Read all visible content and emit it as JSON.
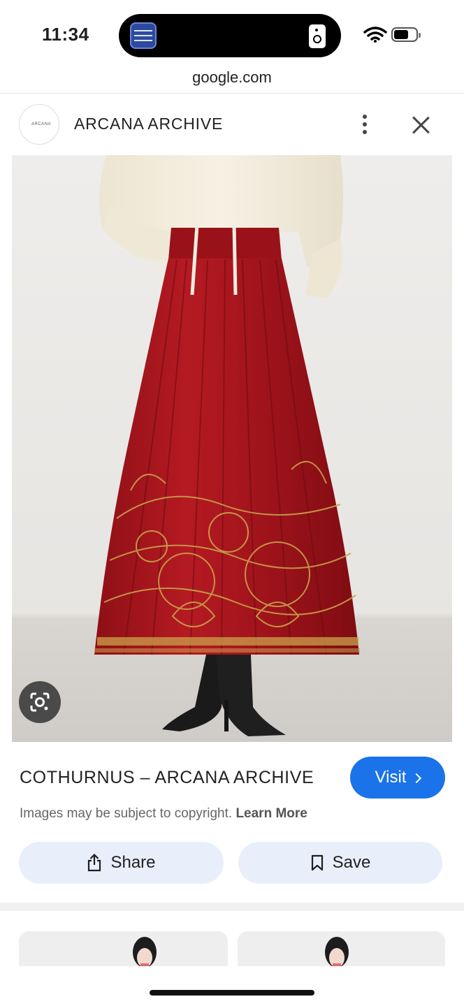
{
  "status_bar": {
    "time": "11:34",
    "island_app_icon": "masters-in-business-podcast-icon",
    "island_right_icon": "speaker-icon"
  },
  "browser": {
    "url": "google.com"
  },
  "site": {
    "logo_text": "ARCANA",
    "name": "ARCANA ARCHIVE",
    "more_icon": "more-vert-icon",
    "close_icon": "close-icon"
  },
  "image": {
    "description_icon": "google-lens-icon",
    "colors": {
      "skirt": "#a3141c",
      "embroidery": "#c9a24a",
      "shirt": "#f4efe2",
      "background": "#e9e7e4",
      "boots": "#1a1a1a"
    }
  },
  "result": {
    "title": "COTHURNUS – ARCANA ARCHIVE",
    "visit_label": "Visit",
    "copyright_text": "Images may be subject to copyright.",
    "learn_more": "Learn More",
    "share_label": "Share",
    "save_label": "Save"
  },
  "colors": {
    "accent": "#1a73e8",
    "chip_bg": "#e8effb"
  }
}
